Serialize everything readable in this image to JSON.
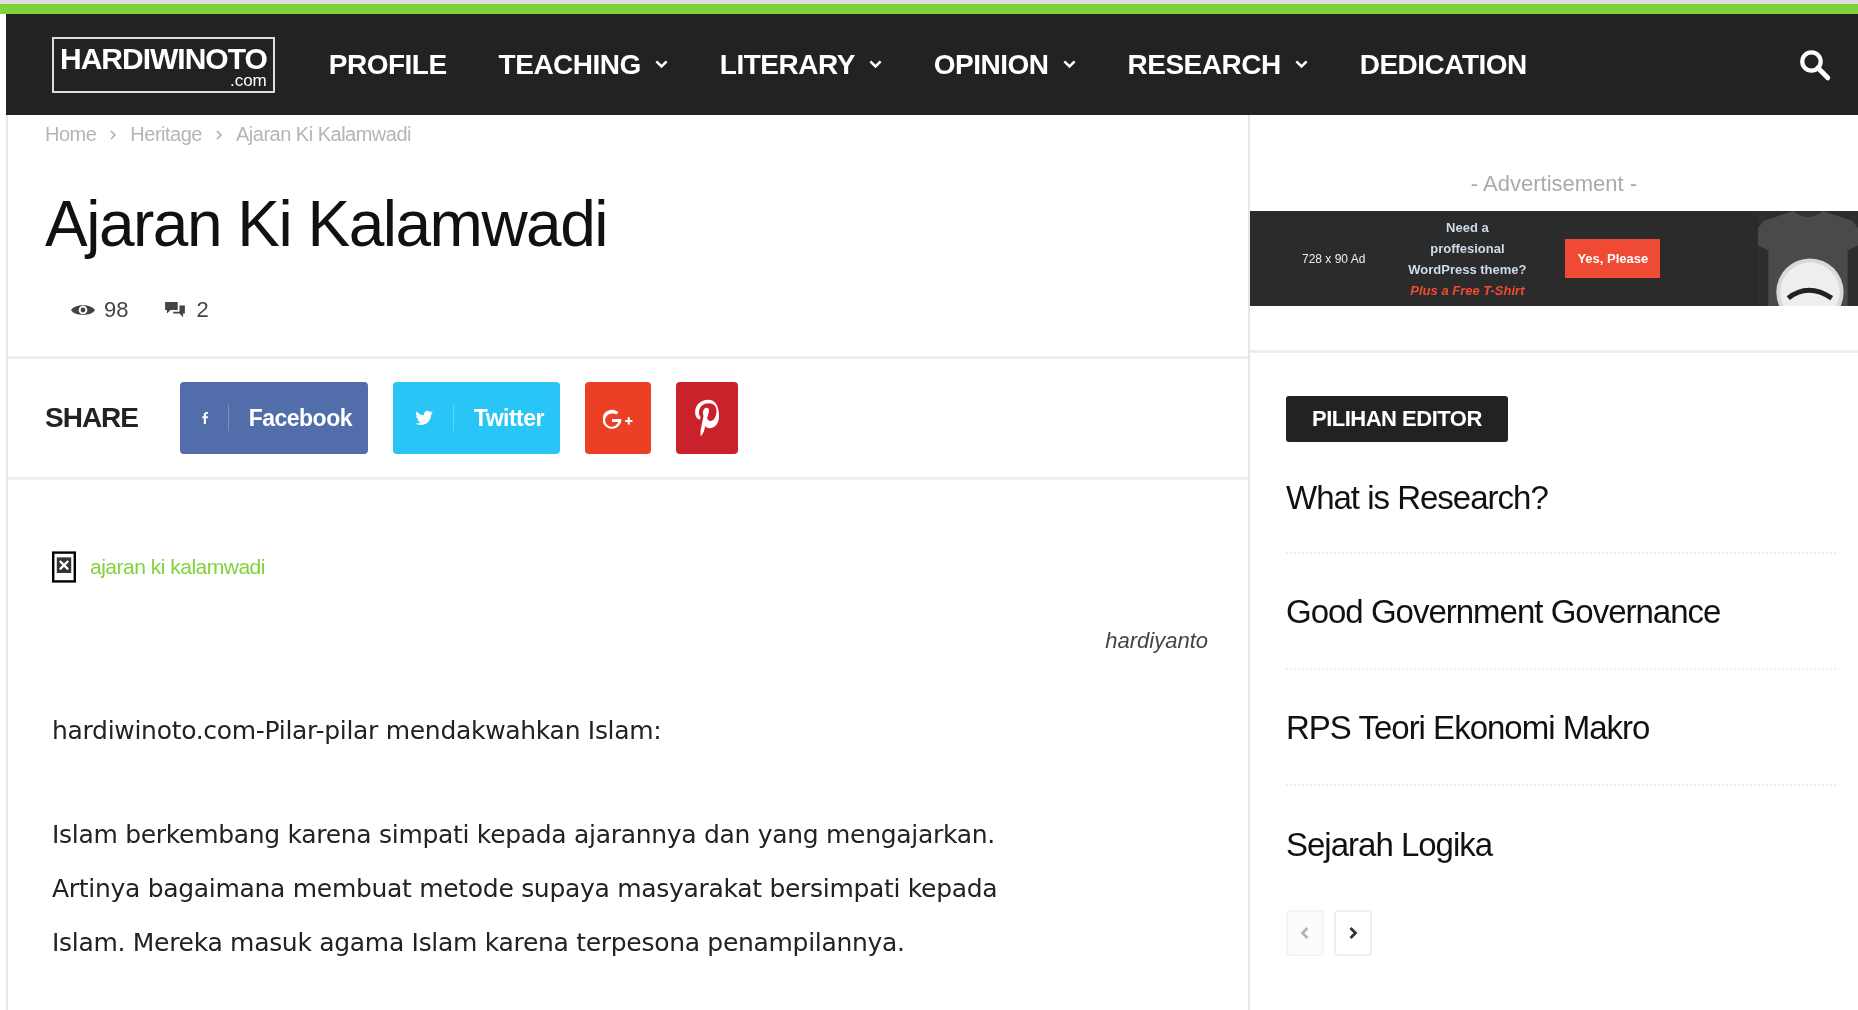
{
  "header": {
    "logo": {
      "name": "HARDIWINOTO",
      "suffix": ".com"
    },
    "nav": [
      {
        "label": "PROFILE",
        "dropdown": false
      },
      {
        "label": "TEACHING",
        "dropdown": true
      },
      {
        "label": "LITERARY",
        "dropdown": true
      },
      {
        "label": "OPINION",
        "dropdown": true
      },
      {
        "label": "RESEARCH",
        "dropdown": true
      },
      {
        "label": "DEDICATION",
        "dropdown": false
      }
    ]
  },
  "breadcrumbs": [
    "Home",
    "Heritage",
    "Ajaran Ki Kalamwadi"
  ],
  "article": {
    "title": "Ajaran Ki Kalamwadi",
    "views": "98",
    "comments": "2",
    "share": {
      "label": "SHARE",
      "buttons": [
        {
          "kind": "facebook",
          "label": "Facebook"
        },
        {
          "kind": "twitter",
          "label": "Twitter"
        },
        {
          "kind": "googleplus"
        },
        {
          "kind": "pinterest"
        }
      ]
    },
    "image_link": "ajaran ki kalamwadi",
    "author": "hardiyanto",
    "paragraphs": [
      "hardiwinoto.com-Pilar-pilar mendakwahkan Islam:",
      "Islam berkembang karena simpati kepada ajarannya dan yang mengajarkan. Artinya bagaimana membuat metode supaya masyarakat bersimpati kepada Islam. Mereka masuk agama Islam karena terpesona penampilannya."
    ]
  },
  "sidebar": {
    "ad_label": "- Advertisement -",
    "ad": {
      "size": "728 x 90 Ad",
      "headline": "Need a proffesional WordPress theme?",
      "offer": "Plus a Free T-Shirt",
      "button": "Yes, Please"
    },
    "editor_pick": {
      "title": "PILIHAN EDITOR",
      "items": [
        "What is Research?",
        "Good Government Governance",
        "RPS Teori Ekonomi Makro",
        "Sejarah Logika"
      ],
      "pager": [
        {
          "kind": "prev",
          "disabled": true
        },
        {
          "kind": "next",
          "disabled": false
        }
      ]
    }
  }
}
